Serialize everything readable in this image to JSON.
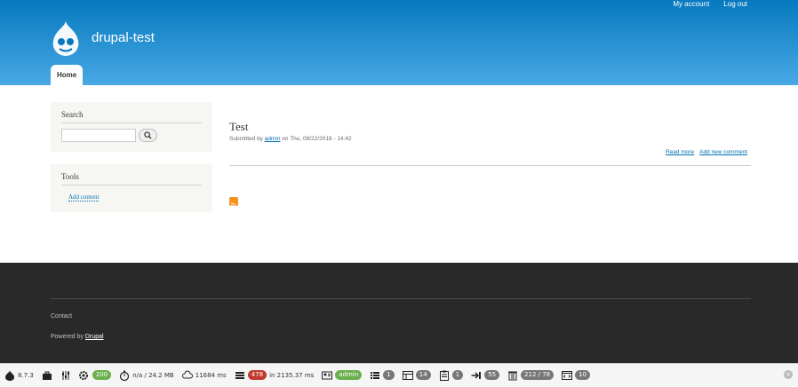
{
  "header": {
    "site_name": "drupal-test",
    "secondary_menu": [
      "My account",
      "Log out"
    ],
    "main_menu": {
      "home": "Home"
    }
  },
  "sidebar": {
    "search": {
      "title": "Search",
      "input_value": "",
      "button_icon": "search-icon"
    },
    "tools": {
      "title": "Tools",
      "link": "Add content"
    }
  },
  "content": {
    "node_title": "Test",
    "submitted_prefix": "Submitted by",
    "author": "admin",
    "submitted_suffix": "on Thu, 08/22/2019 - 14:42",
    "links": [
      "Read more",
      "Add new comment"
    ],
    "feed_icon": "rss-icon"
  },
  "footer": {
    "contact": "Contact",
    "powered_prefix": "Powered by",
    "powered_link": "Drupal"
  },
  "devel_toolbar": {
    "version": "8.7.3",
    "status_code": "200",
    "memory": "n/a / 24.2 MB",
    "time": "11684 ms",
    "queries_count": "478",
    "queries_time": "in 2135.37 ms",
    "user": "admin",
    "blocks": "1",
    "views": "14",
    "forms": "1",
    "events": "55",
    "cache": "212 / 78",
    "assets": "10"
  },
  "colors": {
    "header_top": "#0779bf",
    "header_bottom": "#48a9e4",
    "link": "#0071b3",
    "footer_bg": "#292929",
    "badge_green": "#6ab04c",
    "badge_red": "#c0392b"
  }
}
